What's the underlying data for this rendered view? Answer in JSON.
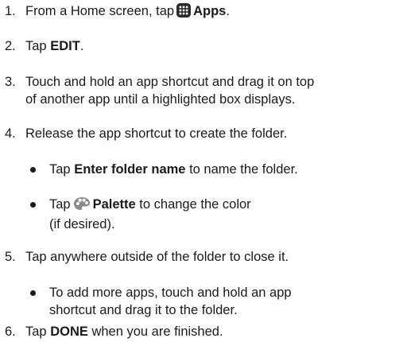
{
  "steps": [
    {
      "num": "1.",
      "pre": "From a Home screen, tap",
      "icon": "apps-grid-icon",
      "bold": "Apps",
      "post": "."
    },
    {
      "num": "2.",
      "pre": "Tap ",
      "bold": "EDIT",
      "post": "."
    },
    {
      "num": "3.",
      "line1": "Touch and hold an app shortcut and drag it on top",
      "line2": "of another app until a highlighted box displays."
    },
    {
      "num": "4.",
      "text": "Release the app shortcut to create the folder."
    },
    {
      "num": "5.",
      "text": "Tap anywhere outside of the folder to close it."
    },
    {
      "num": "6.",
      "pre": "Tap ",
      "bold": "DONE",
      "post": " when you are finished."
    }
  ],
  "bullets": [
    {
      "pre": "Tap ",
      "bold": "Enter folder name",
      "post": " to name the folder."
    },
    {
      "pre": "Tap",
      "icon": "palette-icon",
      "bold": "Palette",
      "line1_post": " to change the color",
      "line2": "(if desired)."
    },
    {
      "line1": "To add more apps, touch and hold an app",
      "line2": "shortcut and drag it to the folder."
    }
  ]
}
